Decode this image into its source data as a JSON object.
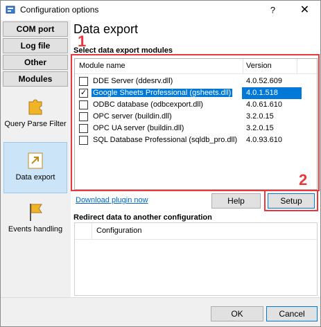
{
  "window": {
    "title": "Configuration options",
    "help_glyph": "?",
    "close_glyph": "✕"
  },
  "sidebar": {
    "tabs": [
      {
        "label": "COM port"
      },
      {
        "label": "Log file"
      },
      {
        "label": "Other"
      },
      {
        "label": "Modules"
      }
    ],
    "items": [
      {
        "label": "Query Parse Filter",
        "icon": "puzzle-icon"
      },
      {
        "label": "Data export",
        "icon": "export-icon",
        "selected": true
      },
      {
        "label": "Events handling",
        "icon": "flag-icon"
      }
    ]
  },
  "main": {
    "title": "Data export",
    "modules_label": "Select data export modules",
    "annotation_1": "1",
    "annotation_2": "2",
    "columns": {
      "name": "Module name",
      "version": "Version"
    },
    "modules": [
      {
        "name": "DDE Server (ddesrv.dll)",
        "version": "4.0.52.609",
        "checked": false,
        "selected": false
      },
      {
        "name": "Google Sheets Professional (gsheets.dll)",
        "version": "4.0.1.518",
        "checked": true,
        "selected": true
      },
      {
        "name": "ODBC database (odbcexport.dll)",
        "version": "4.0.61.610",
        "checked": false,
        "selected": false
      },
      {
        "name": "OPC server (buildin.dll)",
        "version": "3.2.0.15",
        "checked": false,
        "selected": false
      },
      {
        "name": "OPC UA server (buildin.dll)",
        "version": "3.2.0.15",
        "checked": false,
        "selected": false
      },
      {
        "name": "SQL Database Professional (sqldb_pro.dll)",
        "version": "4.0.93.610",
        "checked": false,
        "selected": false
      }
    ],
    "download_link": "Download plugin now",
    "help_button": "Help",
    "setup_button": "Setup",
    "redirect_label": "Redirect data to another configuration",
    "redirect_column": "Configuration"
  },
  "footer": {
    "ok_button": "OK",
    "cancel_button": "Cancel"
  },
  "colors": {
    "accent": "#0078d7",
    "annotation": "#e8383d",
    "link": "#0066cc"
  }
}
